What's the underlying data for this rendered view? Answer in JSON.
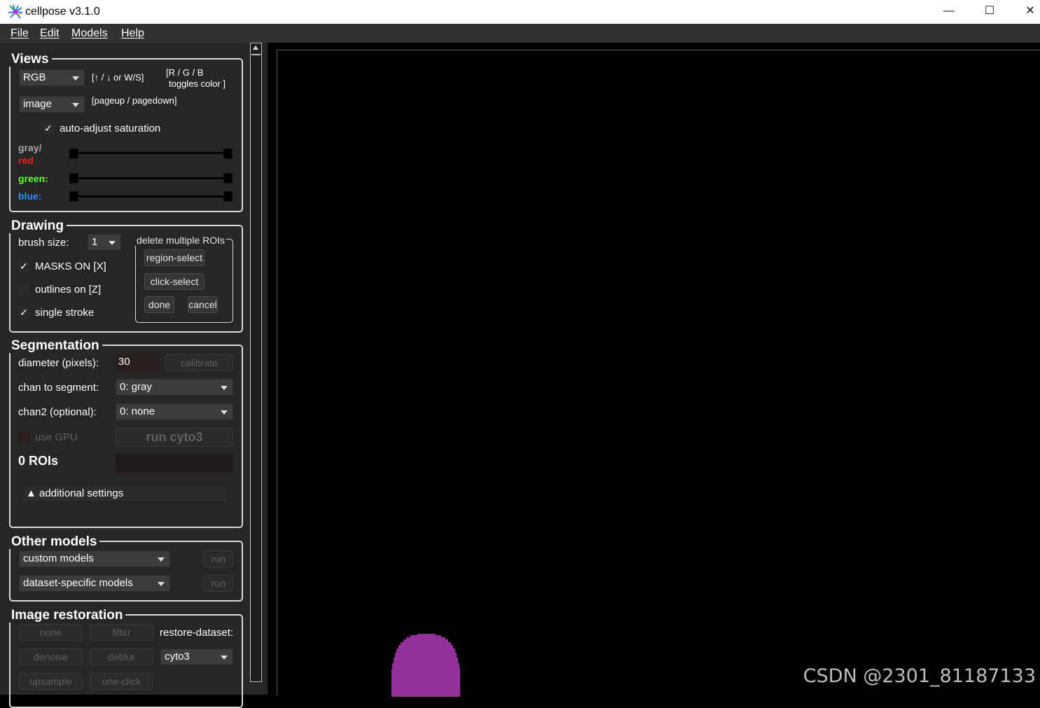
{
  "window": {
    "title": "cellpose v3.1.0",
    "controls": {
      "minimize": "—",
      "maximize": "☐",
      "close": "✕"
    }
  },
  "menu": [
    "File",
    "Edit",
    "Models",
    "Help"
  ],
  "views": {
    "title": "Views",
    "color_mode": "RGB",
    "color_hint": "[↑ / ↓ or W/S]",
    "toggle_hint_1": "[R / G / B",
    "toggle_hint_2": "toggles color ]",
    "view_mode": "image",
    "view_hint": "[pageup / pagedown]",
    "auto_adjust_label": "auto-adjust saturation",
    "auto_adjust_checked": "✓",
    "gray_label": "gray/",
    "red_label": "red",
    "green_label": "green:",
    "blue_label": "blue:"
  },
  "drawing": {
    "title": "Drawing",
    "brush_label": "brush size:",
    "brush_value": "1",
    "masks_label": "MASKS ON [X]",
    "masks_checked": "✓",
    "outlines_label": "outlines on [Z]",
    "outlines_checked": "",
    "single_stroke_label": "single stroke",
    "single_stroke_checked": "✓",
    "delete_group_title": "delete multiple ROIs",
    "region_select": "region-select",
    "click_select": "click-select",
    "done": "done",
    "cancel": "cancel"
  },
  "segmentation": {
    "title": "Segmentation",
    "diameter_label": "diameter (pixels):",
    "diameter_value": "30",
    "calibrate": "calibrate",
    "chan_label": "chan to segment:",
    "chan_value": "0: gray",
    "chan2_label": "chan2 (optional):",
    "chan2_value": "0: none",
    "gpu_label": "use GPU",
    "run_label": "run cyto3",
    "rois_label": "0 ROIs",
    "additional_settings": "▲ additional settings"
  },
  "other_models": {
    "title": "Other models",
    "custom_models": "custom models",
    "dataset_models": "dataset-specific models",
    "run": "run"
  },
  "image_restoration": {
    "title": "Image restoration",
    "none": "none",
    "filter": "filter",
    "restore_dataset_label": "restore-dataset:",
    "denoise": "denoise",
    "deblur": "deblur",
    "restore_dataset_value": "cyto3",
    "upsample": "upsample",
    "one_click": "one-click"
  },
  "colors": {
    "red": "#ff1a1a",
    "green": "#5cff2e",
    "blue": "#2b8cff",
    "cell": "#93309a",
    "panel": "#262626"
  },
  "watermark": "CSDN @2301_81187133"
}
